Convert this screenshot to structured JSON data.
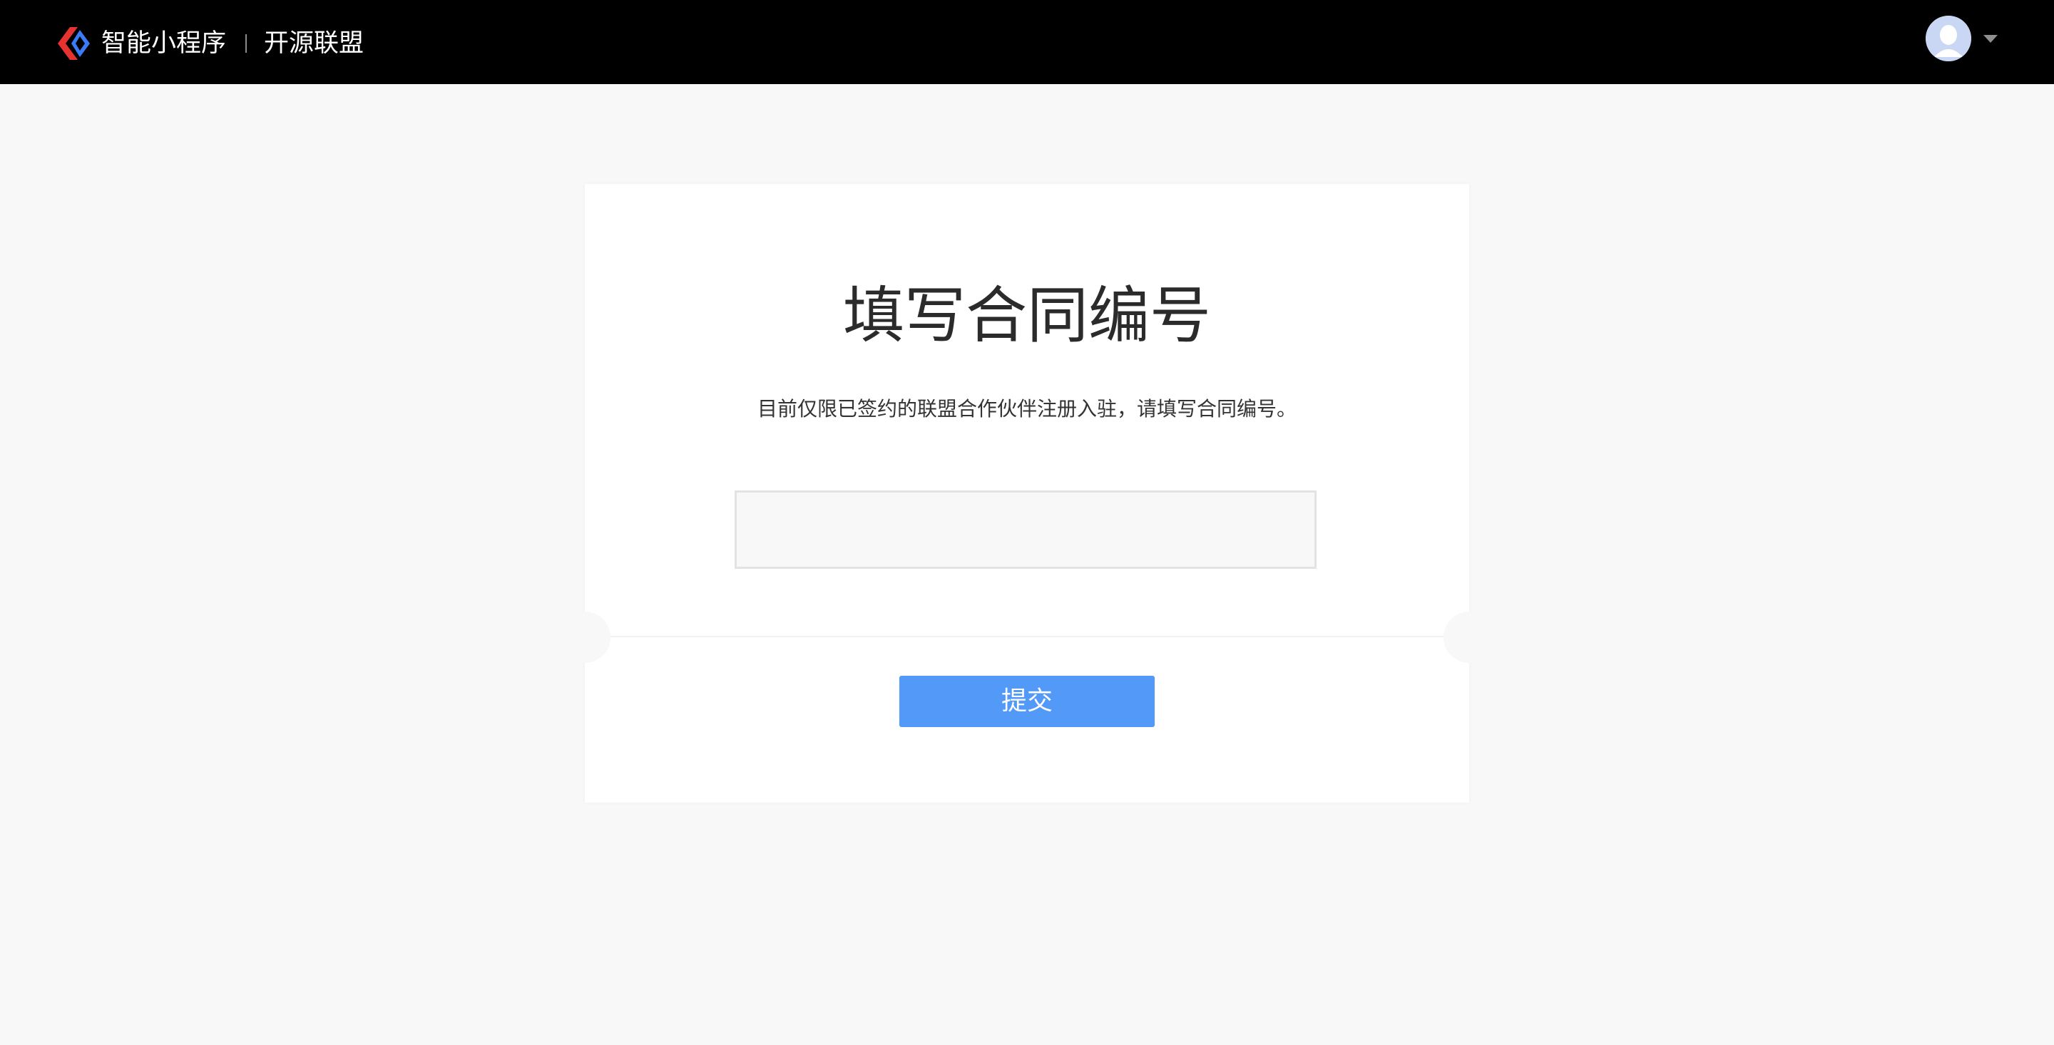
{
  "header": {
    "brand_name": "智能小程序",
    "brand_separator": "|",
    "brand_subtitle": "开源联盟",
    "avatar_icon": "user-avatar-icon",
    "dropdown_icon": "caret-down-icon",
    "logo_colors": {
      "left_chevron": "#e5342f",
      "right_chevron": "#3b7bf6"
    }
  },
  "form": {
    "title": "填写合同编号",
    "description": "目前仅限已签约的联盟合作伙伴注册入驻，请填写合同编号。",
    "contract_input": {
      "value": "",
      "placeholder": ""
    },
    "submit_label": "提交"
  },
  "colors": {
    "header_bg": "#000000",
    "page_bg": "#f8f8f8",
    "card_bg": "#ffffff",
    "accent": "#5299f8"
  }
}
